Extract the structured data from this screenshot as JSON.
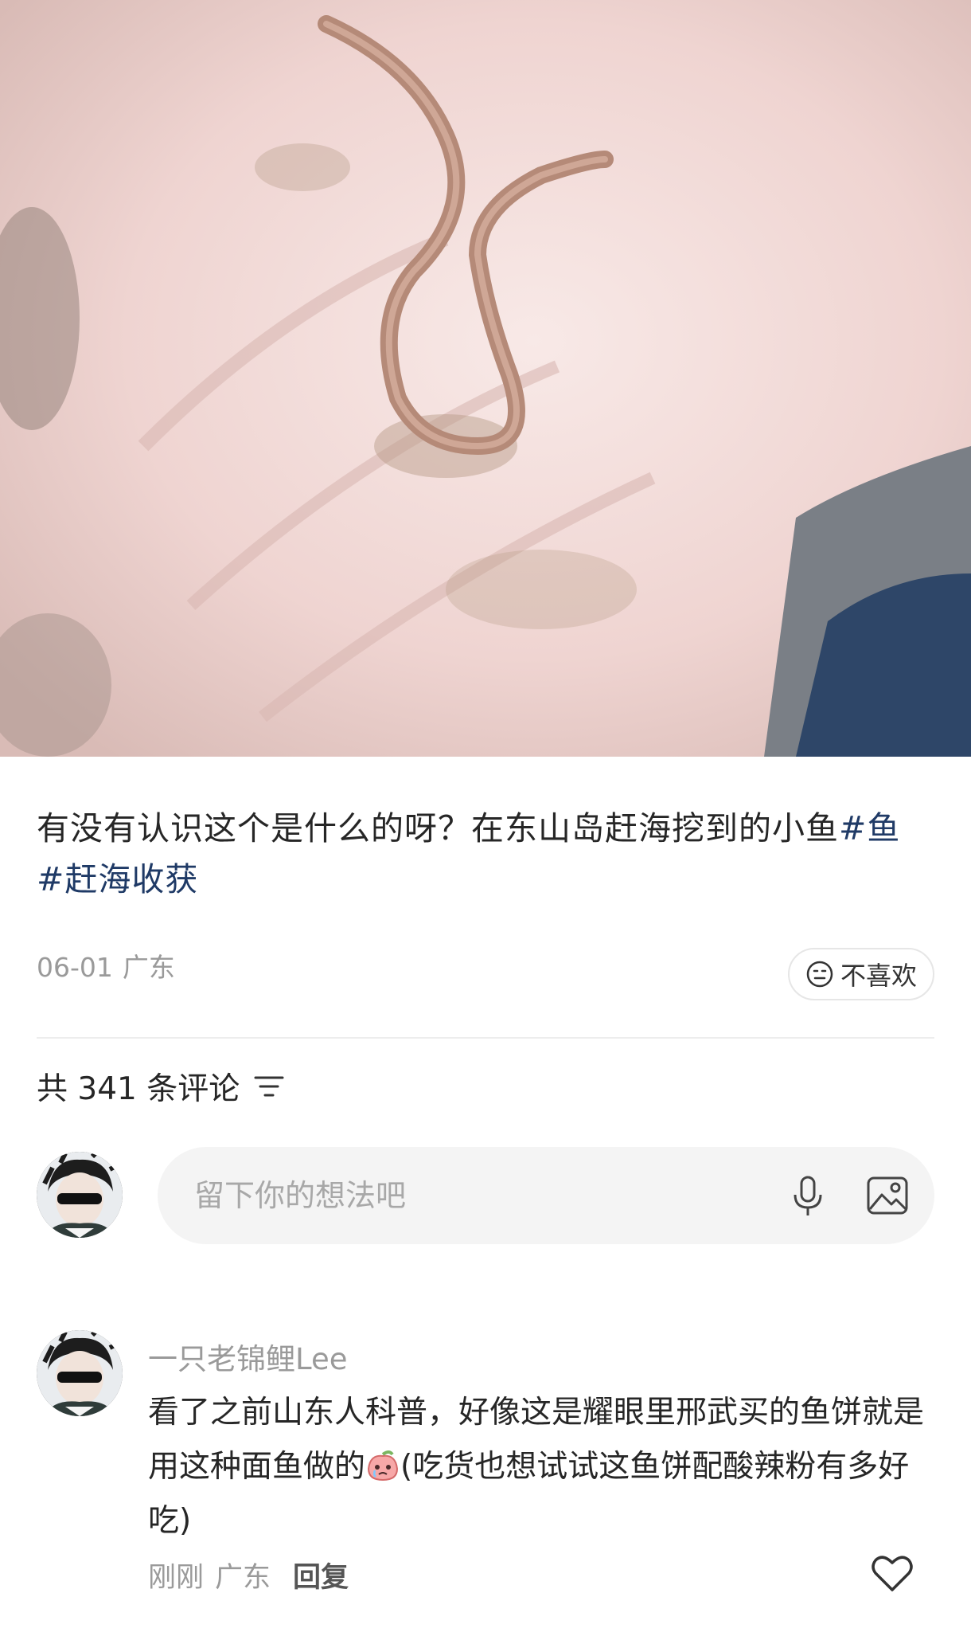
{
  "post": {
    "text": "有没有认识这个是什么的呀？在东山岛赶海挖到的小鱼",
    "tags": [
      "#鱼",
      "#赶海收获"
    ],
    "date": "06-01",
    "location": "广东",
    "dislike_label": "不喜欢"
  },
  "comments_header": {
    "count_label": "共 341 条评论"
  },
  "comment_input": {
    "placeholder": "留下你的想法吧"
  },
  "comments": [
    {
      "user": "一只老锦鲤Lee",
      "text_before_emoji": "看了之前山东人科普，好像这是耀眼里邢武买的鱼饼就是用这种面鱼做的",
      "text_after_emoji": "(吃货也想试试这鱼饼配酸辣粉有多好吃)",
      "time": "刚刚",
      "location": "广东",
      "reply_label": "回复"
    }
  ],
  "icons": {
    "dislike": "neutral-face-icon",
    "sort": "sort-icon",
    "mic": "microphone-icon",
    "image": "image-icon",
    "like": "heart-icon",
    "emoji": "crying-peach-emoji-icon"
  },
  "colors": {
    "tag": "#1f3a66",
    "muted": "#9a9a9a",
    "input_bg": "#f4f4f4"
  }
}
